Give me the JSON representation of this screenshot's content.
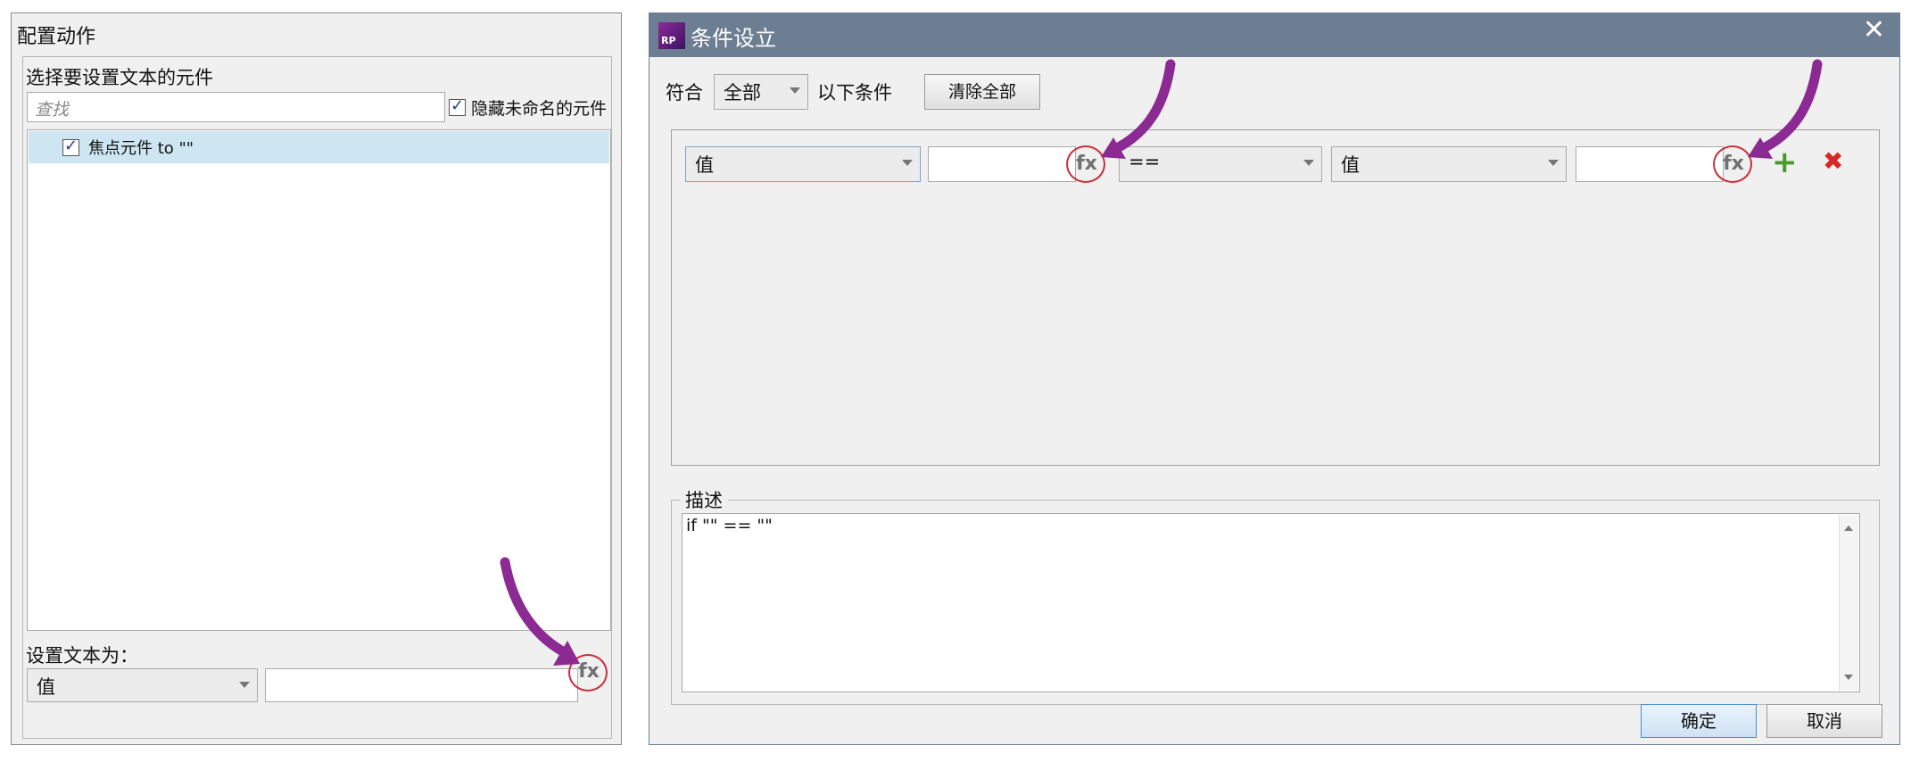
{
  "left_panel": {
    "title": "配置动作",
    "select_label": "选择要设置文本的元件",
    "search_placeholder": "查找",
    "hide_unnamed_label": "隐藏未命名的元件",
    "hide_unnamed_checked": true,
    "list_items": [
      {
        "label": "焦点元件 to \"\"",
        "checked": true,
        "selected": true
      }
    ],
    "set_text_label": "设置文本为：",
    "value_type": "值",
    "value_text": "",
    "fx_label": "fx"
  },
  "dialog": {
    "title": "条件设立",
    "app_icon_text": "RP",
    "close_symbol": "✕",
    "match_label": "符合",
    "match_value": "全部",
    "match_suffix": "以下条件",
    "clear_all_label": "清除全部",
    "condition": {
      "left_type": "值",
      "left_value": "",
      "left_fx": "fx",
      "operator": "==",
      "right_type": "值",
      "right_value": "",
      "right_fx": "fx",
      "add_symbol": "+",
      "delete_symbol": "✖"
    },
    "description_label": "描述",
    "description_text": "if \"\" == \"\"",
    "ok_label": "确定",
    "cancel_label": "取消"
  },
  "colors": {
    "annotation_arrow": "#8b2a92",
    "fx_highlight_ring": "#c8303a",
    "titlebar": "#6d7d92",
    "selected_row": "#cde6f2",
    "add_icon": "#4a9a2a",
    "delete_icon": "#d42a26"
  }
}
